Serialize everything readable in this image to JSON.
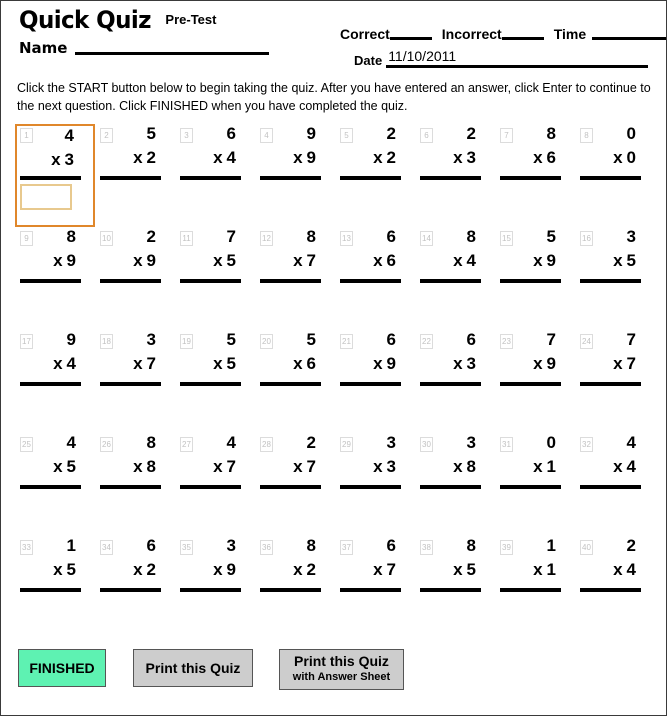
{
  "header": {
    "title": "Quick Quiz",
    "subtitle": "Pre-Test",
    "name_label": "Name",
    "correct_label": "Correct",
    "incorrect_label": "Incorrect",
    "time_label": "Time",
    "date_label": "Date",
    "date_value": "11/10/2011"
  },
  "instructions": {
    "text": "Click the START button below to begin taking the quiz. After you have entered an answer, click Enter to continue to the next question. Click FINISHED when you have completed the quiz."
  },
  "quiz": {
    "operator": "x",
    "active_index": 0,
    "answer_value": "",
    "problems": [
      {
        "n": "1",
        "a": "4",
        "b": "3"
      },
      {
        "n": "2",
        "a": "5",
        "b": "2"
      },
      {
        "n": "3",
        "a": "6",
        "b": "4"
      },
      {
        "n": "4",
        "a": "9",
        "b": "9"
      },
      {
        "n": "5",
        "a": "2",
        "b": "2"
      },
      {
        "n": "6",
        "a": "2",
        "b": "3"
      },
      {
        "n": "7",
        "a": "8",
        "b": "6"
      },
      {
        "n": "8",
        "a": "0",
        "b": "0"
      },
      {
        "n": "9",
        "a": "8",
        "b": "9"
      },
      {
        "n": "10",
        "a": "2",
        "b": "9"
      },
      {
        "n": "11",
        "a": "7",
        "b": "5"
      },
      {
        "n": "12",
        "a": "8",
        "b": "7"
      },
      {
        "n": "13",
        "a": "6",
        "b": "6"
      },
      {
        "n": "14",
        "a": "8",
        "b": "4"
      },
      {
        "n": "15",
        "a": "5",
        "b": "9"
      },
      {
        "n": "16",
        "a": "3",
        "b": "5"
      },
      {
        "n": "17",
        "a": "9",
        "b": "4"
      },
      {
        "n": "18",
        "a": "3",
        "b": "7"
      },
      {
        "n": "19",
        "a": "5",
        "b": "5"
      },
      {
        "n": "20",
        "a": "5",
        "b": "6"
      },
      {
        "n": "21",
        "a": "6",
        "b": "9"
      },
      {
        "n": "22",
        "a": "6",
        "b": "3"
      },
      {
        "n": "23",
        "a": "7",
        "b": "9"
      },
      {
        "n": "24",
        "a": "7",
        "b": "7"
      },
      {
        "n": "25",
        "a": "4",
        "b": "5"
      },
      {
        "n": "26",
        "a": "8",
        "b": "8"
      },
      {
        "n": "27",
        "a": "4",
        "b": "7"
      },
      {
        "n": "28",
        "a": "2",
        "b": "7"
      },
      {
        "n": "29",
        "a": "3",
        "b": "3"
      },
      {
        "n": "30",
        "a": "3",
        "b": "8"
      },
      {
        "n": "31",
        "a": "0",
        "b": "1"
      },
      {
        "n": "32",
        "a": "4",
        "b": "4"
      },
      {
        "n": "33",
        "a": "1",
        "b": "5"
      },
      {
        "n": "34",
        "a": "6",
        "b": "2"
      },
      {
        "n": "35",
        "a": "3",
        "b": "9"
      },
      {
        "n": "36",
        "a": "8",
        "b": "2"
      },
      {
        "n": "37",
        "a": "6",
        "b": "7"
      },
      {
        "n": "38",
        "a": "8",
        "b": "5"
      },
      {
        "n": "39",
        "a": "1",
        "b": "1"
      },
      {
        "n": "40",
        "a": "2",
        "b": "4"
      }
    ]
  },
  "buttons": {
    "finished": "FINISHED",
    "print": "Print this Quiz",
    "print_answers_line1": "Print this Quiz",
    "print_answers_line2": "with Answer Sheet"
  },
  "colors": {
    "active_border": "#e0872b",
    "answer_box_border": "#e8c98e",
    "finished_bg": "#5ef2b2",
    "print_bg": "#cdcdcd",
    "number_badge": "#c2c2c2"
  }
}
